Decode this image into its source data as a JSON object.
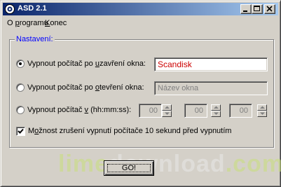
{
  "window": {
    "title": "ASD 2.1"
  },
  "menu": {
    "items": [
      {
        "label_pre": "O ",
        "label_u": "p",
        "label_post": "rogramu"
      },
      {
        "label_pre": "",
        "label_u": "K",
        "label_post": "onec"
      }
    ]
  },
  "group": {
    "legend": "Nastavení:"
  },
  "options": {
    "close": {
      "label_pre": "Vypnout počítač po ",
      "label_u": "u",
      "label_post": "zavření okna:",
      "value": "Scandisk",
      "selected": true
    },
    "open": {
      "label_pre": "Vypnout počítač po ",
      "label_u": "o",
      "label_post": "tevření okna:",
      "placeholder": "Název okna",
      "selected": false
    },
    "time": {
      "label_pre": "Vypnout počítač ",
      "label_u": "v",
      "label_post": " (hh:mm:ss):",
      "hh": "00",
      "mm": "00",
      "ss": "00",
      "selected": false
    }
  },
  "checkbox": {
    "label_pre": "M",
    "label_u": "o",
    "label_post": "žnost zrušení vypnutí počítače 10 sekund před vypnutím",
    "checked": true
  },
  "button": {
    "label": "GO!"
  },
  "watermark": {
    "part1": "lime",
    "part2": "download",
    "part3": ".com"
  },
  "colors": {
    "titlebar_start": "#0a246a",
    "titlebar_end": "#a6caf0",
    "legend": "#0000ff",
    "value_text": "#cc0000"
  }
}
